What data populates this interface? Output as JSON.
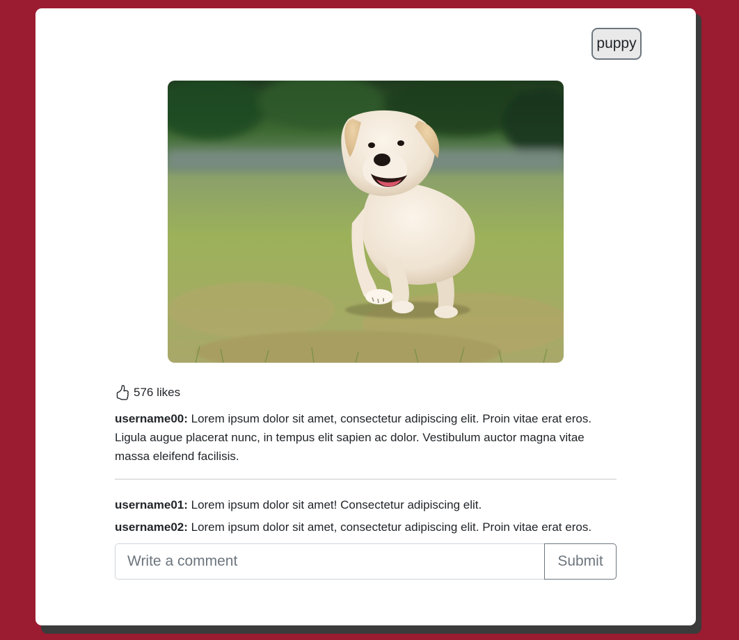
{
  "post": {
    "tag_label": "puppy",
    "image_alt": "Puppy running on grass",
    "likes_text": "576 likes",
    "caption": {
      "username": "username00:",
      "text": " Lorem ipsum dolor sit amet, consectetur adipiscing elit. Proin vitae erat eros. Ligula augue placerat nunc, in tempus elit sapien ac dolor. Vestibulum auctor magna vitae massa eleifend facilisis."
    },
    "comments": [
      {
        "username": "username01:",
        "text": " Lorem ipsum dolor sit amet! Consectetur adipiscing elit."
      },
      {
        "username": "username02:",
        "text": " Lorem ipsum dolor sit amet, consectetur adipiscing elit. Proin vitae erat eros."
      }
    ]
  },
  "comment_form": {
    "placeholder": "Write a comment",
    "submit_label": "Submit"
  },
  "icons": {
    "like": "thumbs-up-icon"
  },
  "colors": {
    "background": "#9b1b30",
    "card": "#ffffff",
    "card_shadow": "#3b3b3b",
    "tag_button_bg": "#e9e9e9",
    "border_gray": "#6c757d"
  }
}
